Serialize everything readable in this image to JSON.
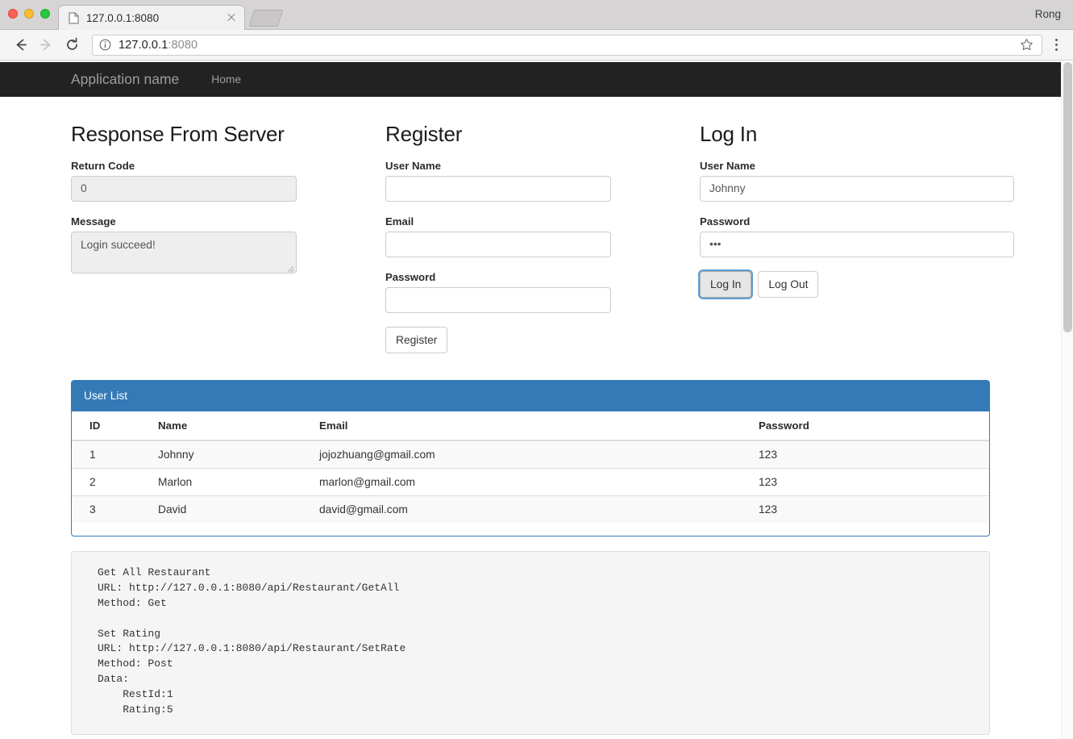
{
  "browser": {
    "tab": {
      "title": "127.0.0.1:8080",
      "favicon_icon": "page-icon",
      "close_icon": "close-icon"
    },
    "new_tab_icon": "new-tab-shape",
    "profile_name": "Rong",
    "nav": {
      "back_icon": "back-arrow-icon",
      "forward_icon": "forward-arrow-icon",
      "reload_icon": "reload-icon",
      "info_icon": "info-circle-icon",
      "star_icon": "star-bookmark-icon",
      "menu_icon": "kebab-menu-icon"
    },
    "url": {
      "host": "127.0.0.1",
      "port": ":8080",
      "full": "127.0.0.1:8080"
    },
    "traffic_lights": {
      "close": "close-window-dot",
      "minimize": "minimize-window-dot",
      "zoom": "zoom-window-dot"
    }
  },
  "navbar": {
    "brand": "Application name",
    "links": [
      {
        "label": "Home"
      }
    ]
  },
  "response_panel": {
    "title": "Response From Server",
    "return_code_label": "Return Code",
    "return_code_value": "0",
    "message_label": "Message",
    "message_value": "Login succeed!"
  },
  "register_panel": {
    "title": "Register",
    "username_label": "User Name",
    "username_value": "",
    "email_label": "Email",
    "email_value": "",
    "password_label": "Password",
    "password_value": "",
    "submit_label": "Register"
  },
  "login_panel": {
    "title": "Log In",
    "username_label": "User Name",
    "username_value": "Johnny",
    "password_label": "Password",
    "password_value": "•••",
    "login_label": "Log In",
    "logout_label": "Log Out"
  },
  "user_list": {
    "heading": "User List",
    "columns": [
      "ID",
      "Name",
      "Email",
      "Password"
    ],
    "rows": [
      {
        "id": "1",
        "name": "Johnny",
        "email": "jojozhuang@gmail.com",
        "password": "123"
      },
      {
        "id": "2",
        "name": "Marlon",
        "email": "marlon@gmail.com",
        "password": "123"
      },
      {
        "id": "3",
        "name": "David",
        "email": "david@gmail.com",
        "password": "123"
      }
    ]
  },
  "api_doc": {
    "text": "Get All Restaurant\nURL: http://127.0.0.1:8080/api/Restaurant/GetAll\nMethod: Get\n\nSet Rating\nURL: http://127.0.0.1:8080/api/Restaurant/SetRate\nMethod: Post\nData:\n    RestId:1\n    Rating:5"
  },
  "colors": {
    "navbar_bg": "#222222",
    "panel_primary": "#337ab7",
    "focus_ring": "#5e9ed6",
    "disabled_bg": "#eeeeee",
    "code_bg": "#f5f5f5"
  }
}
